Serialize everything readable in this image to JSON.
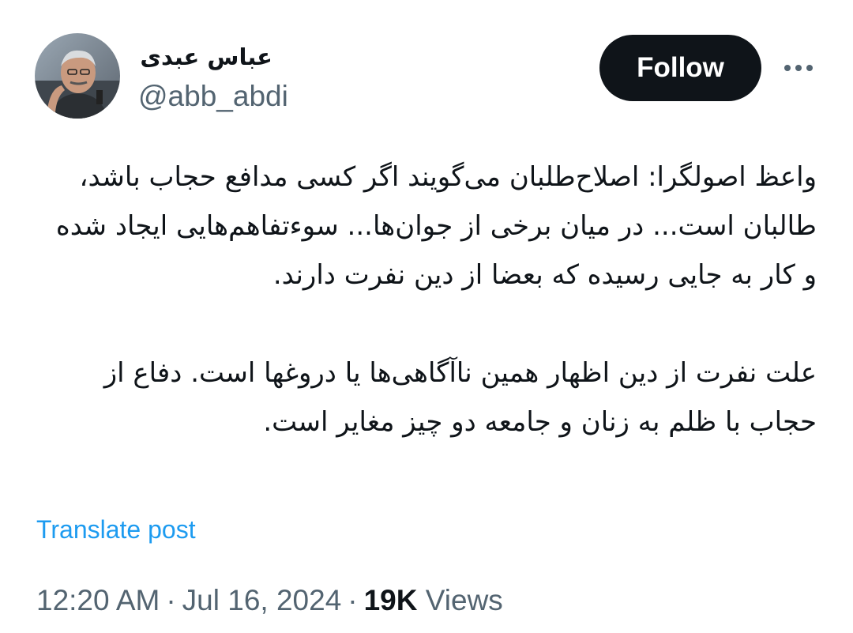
{
  "author": {
    "display_name": "عباس عبدی",
    "handle": "@abb_abdi"
  },
  "header": {
    "follow_label": "Follow"
  },
  "tweet": {
    "paragraph_1": "واعظ اصولگرا: اصلاح‌طلبان می‌گویند اگر کسی مدافع حجاب باشد، طالبان است... در میان برخی از جوان‌ها... سوءتفاهم‌هایی ایجاد شده و کار به جایی رسیده که بعضا از دین نفرت دارند.",
    "paragraph_2": "علت نفرت از دین اظهار همین ناآگاهی‌ها یا دروغها است. دفاع از حجاب با ظلم به زنان و جامعه دو چیز مغایر است."
  },
  "translate_label": "Translate post",
  "meta": {
    "time": "12:20 AM",
    "separator": "·",
    "date": "Jul 16, 2024",
    "views_count": "19K",
    "views_label": "Views"
  },
  "icons": {
    "more": "more-horizontal-icon"
  },
  "colors": {
    "primary_text": "#0f1419",
    "secondary_text": "#536471",
    "link": "#1d9bf0",
    "button_bg": "#0f1419"
  }
}
